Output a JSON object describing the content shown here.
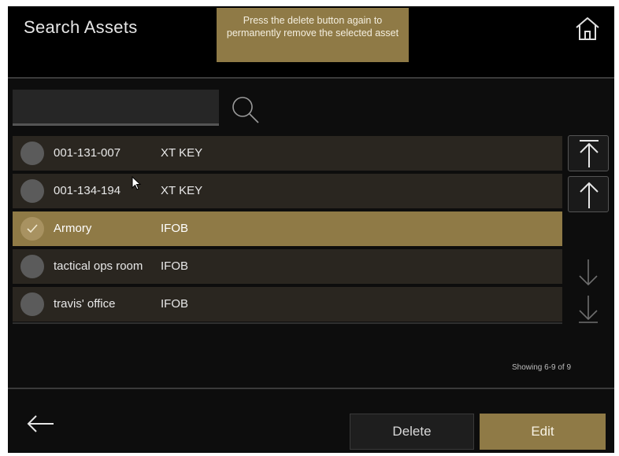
{
  "header": {
    "title": "Search Assets",
    "toast": "Press the delete button again to permanently remove the selected asset",
    "home_icon": "home-icon"
  },
  "search": {
    "value": "",
    "icon": "search-icon"
  },
  "assets": [
    {
      "name": "001-131-007",
      "type": "XT KEY",
      "selected": false
    },
    {
      "name": "001-134-194",
      "type": "XT KEY",
      "selected": false
    },
    {
      "name": "Armory",
      "type": "IFOB",
      "selected": true
    },
    {
      "name": "tactical ops room",
      "type": "IFOB",
      "selected": false
    },
    {
      "name": "travis' office",
      "type": "IFOB",
      "selected": false
    }
  ],
  "scroll_controls": [
    "scroll-to-top-icon",
    "arrow-up-icon",
    "arrow-down-icon",
    "scroll-to-bottom-icon"
  ],
  "status": "Showing 6-9 of 9",
  "footer": {
    "back_icon": "arrow-left-icon",
    "delete_label": "Delete",
    "edit_label": "Edit"
  },
  "colors": {
    "accent_gold": "#8f7a46",
    "background": "#0d0d0d",
    "row_background": "#2a2620"
  }
}
